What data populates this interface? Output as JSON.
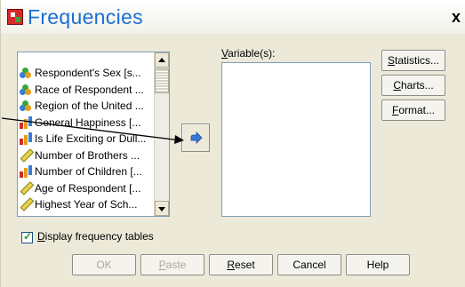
{
  "window": {
    "title": "Frequencies",
    "close_glyph": "x"
  },
  "source_list": {
    "items": [
      {
        "label": "Respondent's Sex [s...",
        "icon": "nominal-icon"
      },
      {
        "label": "Race of Respondent ...",
        "icon": "nominal-icon"
      },
      {
        "label": "Region of the United ...",
        "icon": "nominal-icon"
      },
      {
        "label": "General Happiness [...",
        "icon": "ordinal-icon"
      },
      {
        "label": "Is Life Exciting or Dull...",
        "icon": "ordinal-icon"
      },
      {
        "label": "Number of Brothers ...",
        "icon": "scale-icon"
      },
      {
        "label": "Number of Children [...",
        "icon": "ordinal-icon"
      },
      {
        "label": "Age of Respondent [...",
        "icon": "scale-icon"
      },
      {
        "label": "Highest Year of Sch...",
        "icon": "scale-icon"
      }
    ]
  },
  "target": {
    "label_prefix": "V",
    "label_rest": "ariable(s):"
  },
  "side_buttons": {
    "statistics": {
      "u": "S",
      "rest": "tatistics..."
    },
    "charts": {
      "u": "C",
      "rest": "harts..."
    },
    "format": {
      "u": "F",
      "rest": "ormat..."
    }
  },
  "checkbox": {
    "u": "D",
    "rest": "isplay frequency tables",
    "checked": true
  },
  "bottom_buttons": {
    "ok": "OK",
    "paste": {
      "u": "P",
      "rest": "aste"
    },
    "reset": {
      "u": "R",
      "rest": "eset"
    },
    "cancel": "Cancel",
    "help": "Help"
  },
  "colors": {
    "title": "#1a6fd4",
    "dialog_bg": "#ece9d8",
    "list_border": "#7f9db9"
  }
}
